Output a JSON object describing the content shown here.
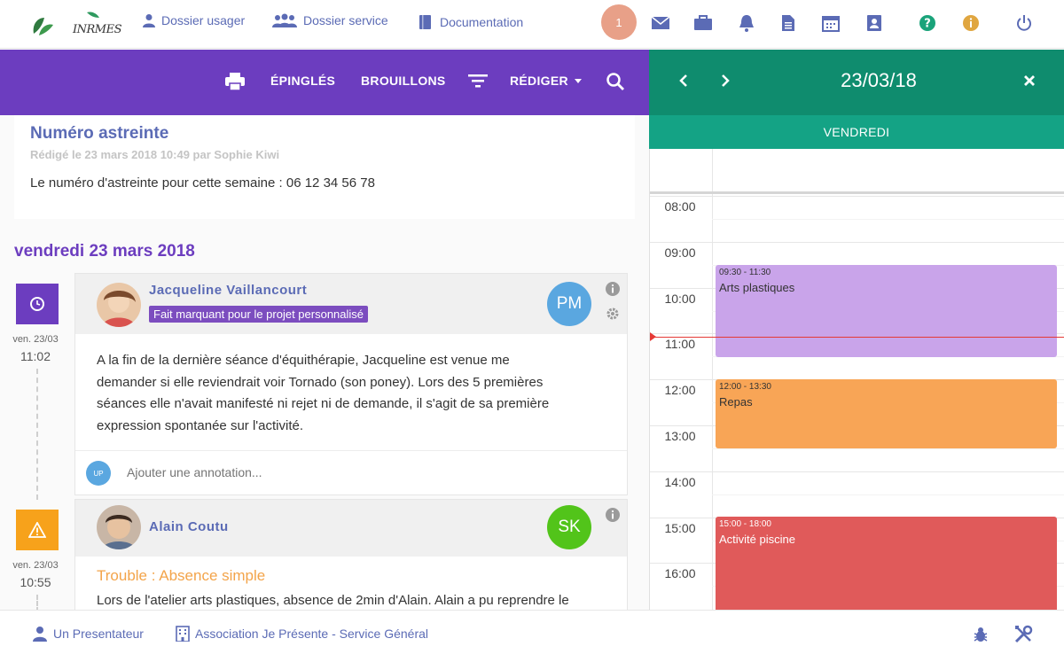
{
  "topbar": {
    "logo_text": "INRMES",
    "nav": [
      {
        "label": "Dossier usager"
      },
      {
        "label": "Dossier service"
      },
      {
        "label": "Documentation"
      }
    ],
    "notification_count": "1"
  },
  "toolbar": {
    "pinned_label": "ÉPINGLÉS",
    "drafts_label": "BROUILLONS",
    "compose_label": "RÉDIGER"
  },
  "pinned_note": {
    "title": "Numéro astreinte",
    "meta": "Rédigé le 23 mars 2018 10:49 par Sophie Kiwi",
    "body": "Le numéro d'astreinte pour cette semaine : 06 12 34 56 78"
  },
  "day_heading": "vendredi 23 mars 2018",
  "posts": [
    {
      "date": "ven. 23/03",
      "time": "11:02",
      "author": "Jacqueline Vaillancourt",
      "tag": "Fait marquant pour le projet personnalisé",
      "initials": "PM",
      "body_lines": [
        "A la fin de la dernière séance d'équithérapie, Jacqueline est venue me",
        "demander si elle reviendrait voir Tornado (son poney). Lors des 5 premières",
        "séances elle n'avait manifesté ni rejet ni de demande, il s'agit de sa première",
        "expression spontanée sur l'activité."
      ],
      "annotation_avatar": "UP",
      "annotation_placeholder": "Ajouter une annotation..."
    },
    {
      "date": "ven. 23/03",
      "time": "10:55",
      "author": "Alain Coutu",
      "initials": "SK",
      "category": "Trouble : Absence simple",
      "body_lines": [
        "Lors de l'atelier arts plastiques, absence de 2min d'Alain. Alain a pu reprendre le"
      ]
    }
  ],
  "calendar": {
    "date": "23/03/18",
    "weekday": "VENDREDI",
    "hours": [
      "08:00",
      "09:00",
      "10:00",
      "11:00",
      "12:00",
      "13:00",
      "14:00",
      "15:00",
      "16:00"
    ],
    "events": [
      {
        "time": "09:30 - 11:30",
        "title": "Arts plastiques",
        "color": "#c9a4ea"
      },
      {
        "time": "12:00 - 13:30",
        "title": "Repas",
        "color": "#f8a556"
      },
      {
        "time": "15:00 - 18:00",
        "title": "Activité piscine",
        "color": "#e05a5a"
      }
    ]
  },
  "footer": {
    "user": "Un Presentateur",
    "org": "Association Je Présente - Service Général"
  },
  "colors": {
    "purple": "#6c3dbf",
    "teal": "#0f8c6e",
    "link": "#5b6bb5"
  }
}
